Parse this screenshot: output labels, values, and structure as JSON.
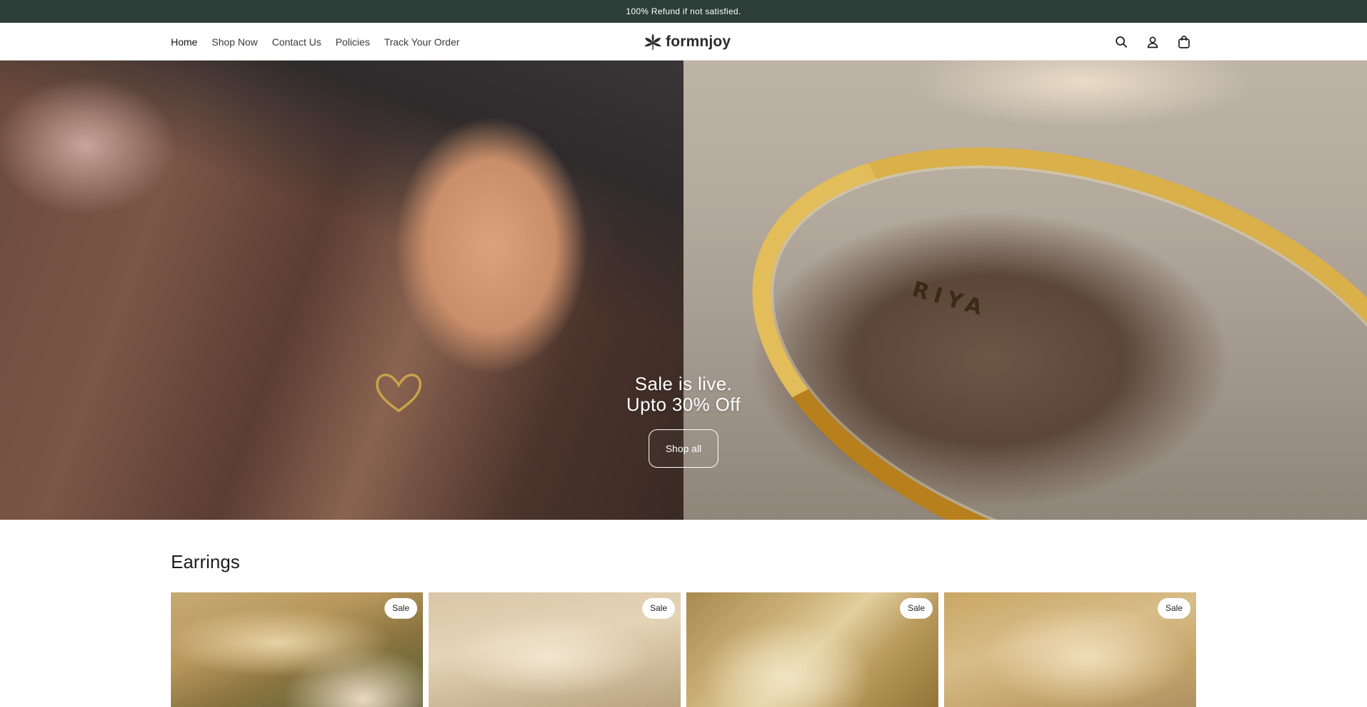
{
  "announcement": {
    "text": "100% Refund if not satisfied."
  },
  "nav": {
    "items": [
      {
        "label": "Home"
      },
      {
        "label": "Shop Now"
      },
      {
        "label": "Contact Us"
      },
      {
        "label": "Policies"
      },
      {
        "label": "Track Your Order"
      }
    ]
  },
  "brand": {
    "name": "formnjoy",
    "icon": "leaf-logo-icon"
  },
  "header_icons": [
    "search-icon",
    "account-icon",
    "cart-icon"
  ],
  "hero": {
    "title_line1": "Sale is live.",
    "title_line2": "Upto 30% Off",
    "button_label": "Shop all",
    "engraving": "RIYA"
  },
  "collection": {
    "title": "Earrings",
    "products": [
      {
        "badge": "Sale"
      },
      {
        "badge": "Sale"
      },
      {
        "badge": "Sale"
      },
      {
        "badge": "Sale"
      }
    ]
  },
  "colors": {
    "announcement_bg": "#2c3e37",
    "text": "#1d1d1d",
    "gold": "#c99a30"
  }
}
